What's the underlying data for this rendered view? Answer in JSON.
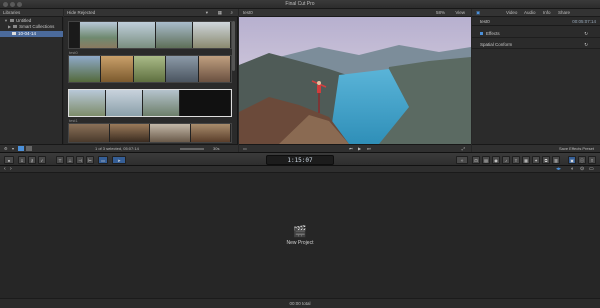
{
  "app": {
    "title": "Final Cut Pro"
  },
  "libraries": {
    "header": "Libraries",
    "items": [
      {
        "label": "Untitled"
      },
      {
        "label": "Smart Collections"
      },
      {
        "label": "10-04-14"
      }
    ]
  },
  "browser": {
    "filter": "Hide Rejected",
    "clip_labels": [
      "test0",
      "test1"
    ],
    "status": "1 of 3 selected, 05:07:14",
    "duration_label": "30s"
  },
  "viewer": {
    "title": "test0",
    "zoom": "58%",
    "view_menu": "View"
  },
  "inspector": {
    "tabs": [
      "Video",
      "Audio",
      "Info",
      "Share"
    ],
    "clip_name": "test0",
    "clip_time": "00:05:07:14",
    "rows": [
      "Effects",
      "Spatial Conform"
    ],
    "save_preset": "Save Effects Preset"
  },
  "toolbar": {
    "timecode": "1:15:07"
  },
  "timeline": {
    "new_project": "New Project"
  },
  "status": {
    "total": "00:00 total"
  }
}
